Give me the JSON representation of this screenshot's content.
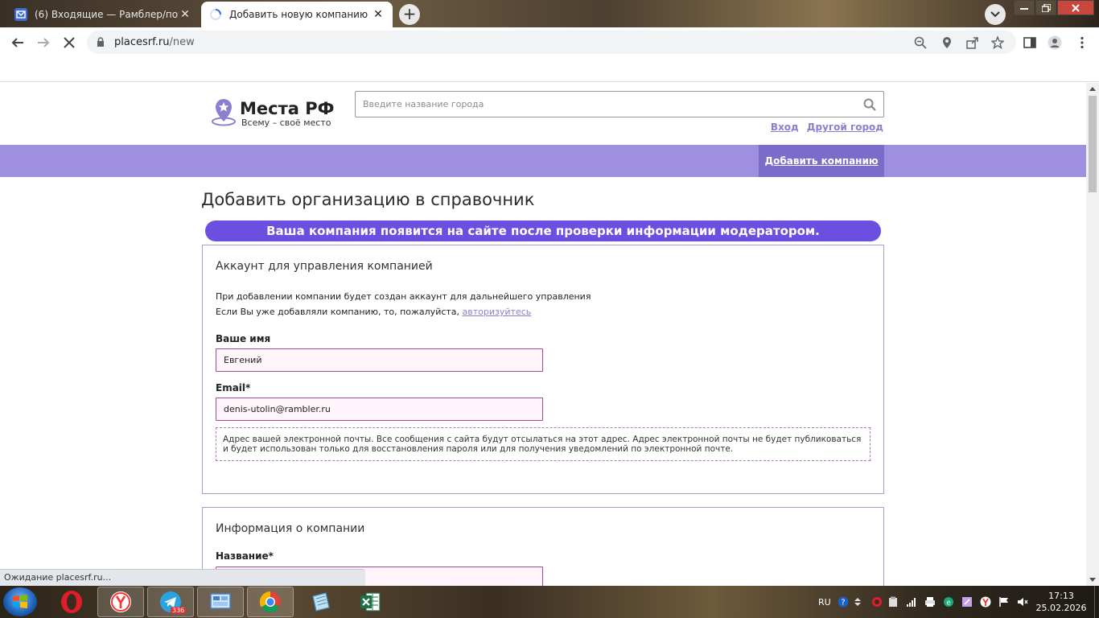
{
  "browser": {
    "tabs": [
      {
        "title": "(6) Входящие — Рамблер/почта",
        "active": false
      },
      {
        "title": "Добавить новую компанию",
        "active": true
      }
    ],
    "url_host": "placesrf.ru",
    "url_path": "/new",
    "status_text": "Ожидание placesrf.ru..."
  },
  "site": {
    "logo_title": "Места РФ",
    "logo_subtitle": "Всему – своё место",
    "search_placeholder": "Введите название города",
    "link_login": "Вход",
    "link_other_city": "Другой город",
    "nav_add_company": "Добавить компанию"
  },
  "page": {
    "heading": "Добавить организацию в справочник",
    "banner": "Ваша компания появится на сайте после проверки информации модератором.",
    "account_section": {
      "title": "Аккаунт для управления компанией",
      "line1": "При добавлении компании будет создан аккаунт для дальнейшего управления",
      "line2_prefix": "Если Вы уже добавляли компанию, то, пожалуйста,",
      "line2_link": "авторизуйтесь",
      "name_label": "Ваше имя",
      "name_value": "Евгений",
      "email_label": "Email*",
      "email_value": "denis-utolin@rambler.ru",
      "email_hint": "Адрес вашей электронной почты. Все сообщения с сайта будут отсылаться на этот адрес. Адрес электронной почты не будет публиковаться и будет использован только для восстановления пароля или для получения уведомлений по электронной почте."
    },
    "company_section": {
      "title": "Информация о компании",
      "name_label": "Название*",
      "name_value": ""
    }
  },
  "taskbar": {
    "language": "RU",
    "telegram_badge": "336",
    "clock_time": "17:13",
    "clock_date": "25.02.2026"
  },
  "colors": {
    "brand_purple": "#9e8fe0",
    "brand_dark": "#7c6bc9",
    "banner": "#6c4fe0",
    "link": "#8b7fd0",
    "input_border": "#a04c9e",
    "input_bg": "#fff5fb"
  }
}
